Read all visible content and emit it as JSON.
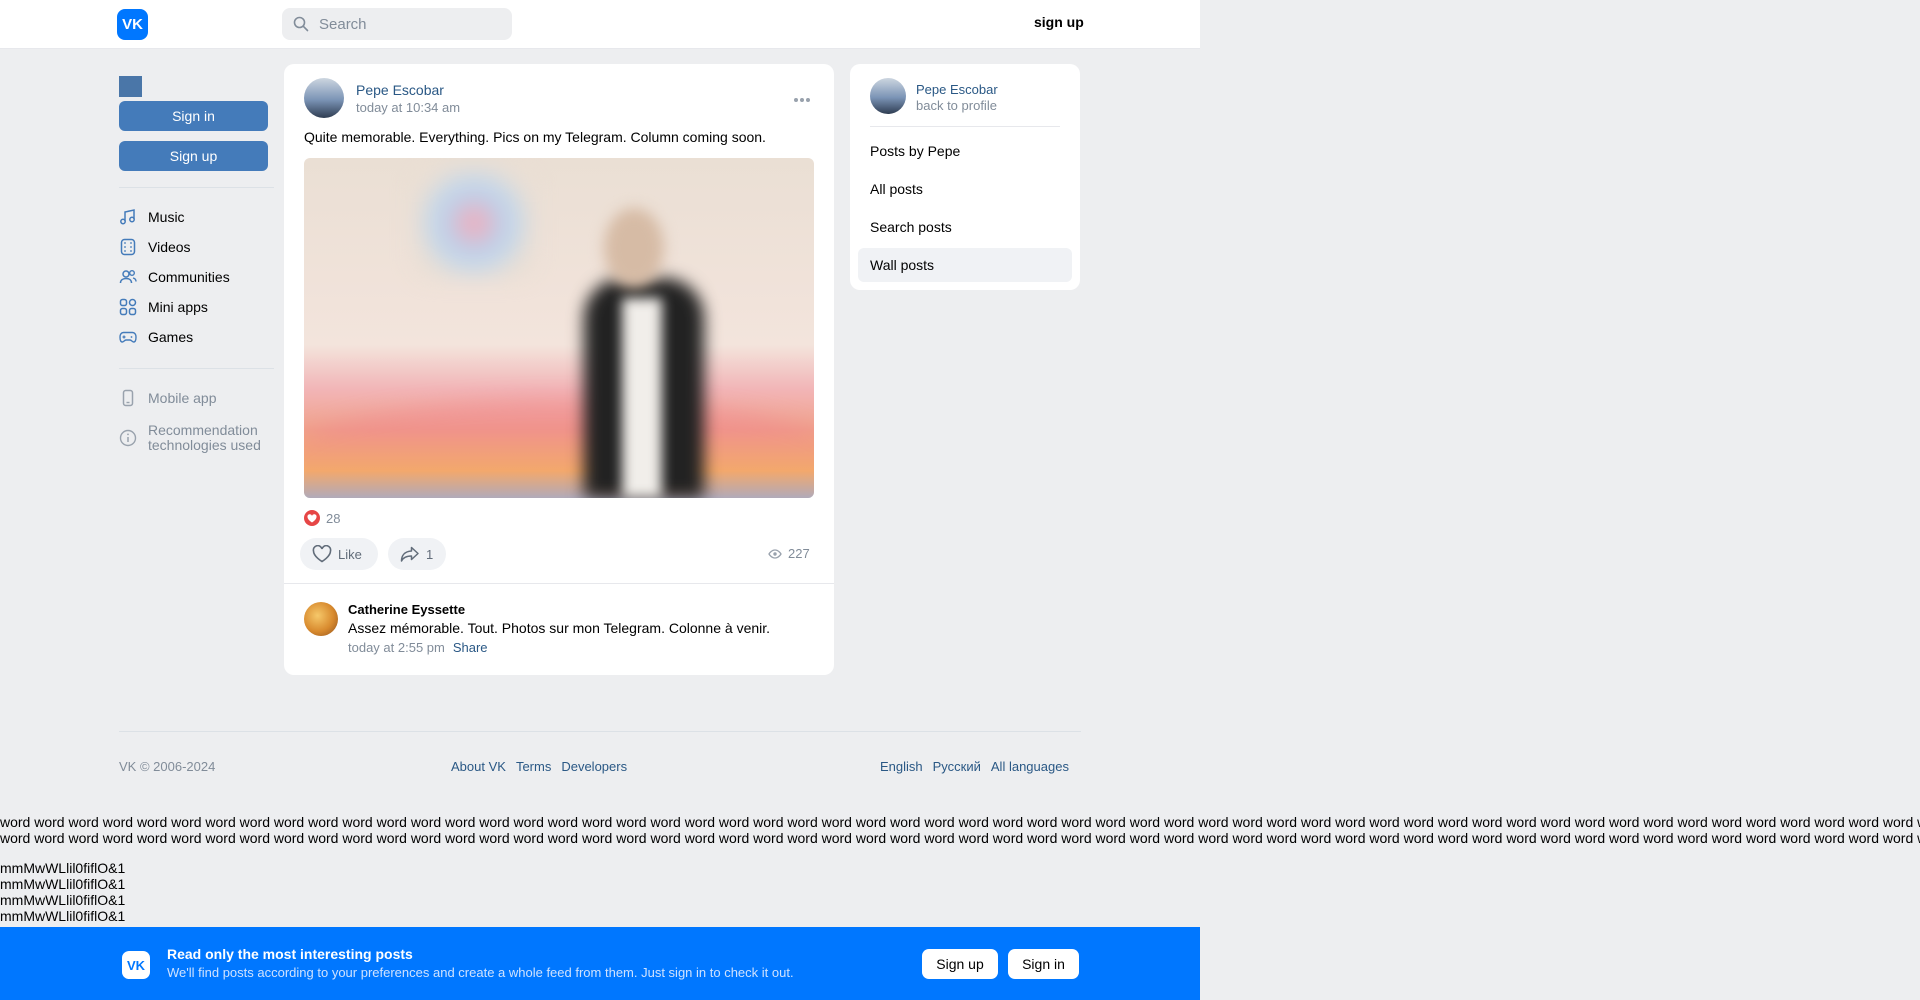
{
  "header": {
    "logo_text": "VK",
    "search_placeholder": "Search",
    "signup_label": "sign up"
  },
  "left_nav": {
    "sign_in_label": "Sign in",
    "sign_up_label": "Sign up",
    "items": [
      {
        "label": "Music",
        "icon": "music-icon"
      },
      {
        "label": "Videos",
        "icon": "video-icon"
      },
      {
        "label": "Communities",
        "icon": "communities-icon"
      },
      {
        "label": "Mini apps",
        "icon": "mini-apps-icon"
      },
      {
        "label": "Games",
        "icon": "gamepad-icon"
      }
    ],
    "mobile_app_label": "Mobile app",
    "recommendation_line1": "Recommendation",
    "recommendation_line2": "technologies used"
  },
  "post": {
    "author": "Pepe Escobar",
    "time": "today at 10:34 am",
    "text": "Quite memorable. Everything. Pics on my Telegram. Column coming soon.",
    "reactions_count": "28",
    "like_label": "Like",
    "share_count": "1",
    "views_count": "227",
    "comment": {
      "author": "Catherine Eyssette",
      "text": "Assez mémorable. Tout. Photos sur mon Telegram. Colonne à venir.",
      "time": "today at 2:55 pm",
      "share_label": "Share"
    }
  },
  "sidebar": {
    "name": "Pepe Escobar",
    "back_label": "back to profile",
    "items": [
      {
        "label": "Posts by Pepe",
        "active": false
      },
      {
        "label": "All posts",
        "active": false
      },
      {
        "label": "Search posts",
        "active": false
      },
      {
        "label": "Wall posts",
        "active": true
      }
    ]
  },
  "footer": {
    "copyright": "VK © 2006-2024",
    "links": [
      "About VK",
      "Terms",
      "Developers"
    ],
    "languages": [
      "English",
      "Русский",
      "All languages"
    ]
  },
  "overflow_text": {
    "word_line": "word word word word word word word word word word word word word word word word word word word word word word word word word word word word word word word word word word word word word word word word word word word word word word word word word word word word word word word word word word word",
    "m_line": "mmMwWLlil0fiflO&1"
  },
  "banner": {
    "logo_text": "VK",
    "title": "Read only the most interesting posts",
    "subtitle": "We'll find posts according to your preferences and create a whole feed from them. Just sign in to check it out.",
    "sign_up_label": "Sign up",
    "sign_in_label": "Sign in"
  },
  "colors": {
    "accent": "#0077ff",
    "button_blue": "#447bba",
    "link": "#2a5885",
    "background": "#edeef0"
  }
}
